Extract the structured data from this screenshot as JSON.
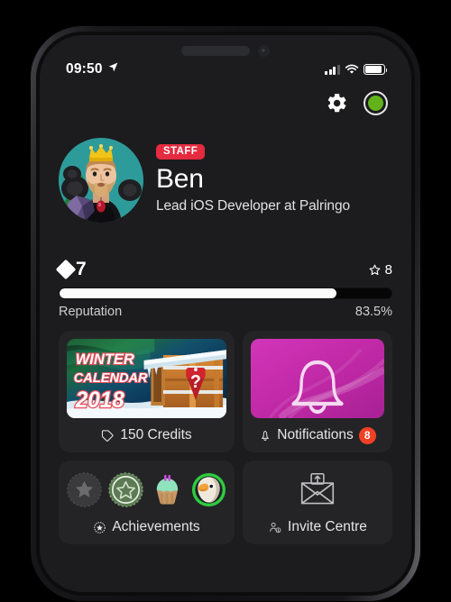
{
  "status_bar": {
    "time": "09:50",
    "location_icon": "location-arrow-icon",
    "signal_icon": "cellular-bars-icon",
    "wifi_icon": "wifi-icon",
    "battery_icon": "battery-full-icon"
  },
  "top_actions": {
    "settings_icon": "gear-icon",
    "online_status_icon": "online-status-dot",
    "online_status_color": "#62b31b"
  },
  "profile": {
    "badge": "STAFF",
    "badge_color": "#e52b3f",
    "name": "Ben",
    "subtitle": "Lead iOS Developer at Palringo",
    "avatar_background": "#2e9b9b",
    "avatar_icon": "user-avatar"
  },
  "reputation": {
    "level_icon": "diamond-icon",
    "level": "7",
    "star_icon": "star-outline-icon",
    "stars": "8",
    "label": "Reputation",
    "percent": "83.5%",
    "progress": 83.5,
    "fill_color": "#fafafa"
  },
  "cards": [
    {
      "name": "winter-calendar",
      "media_type": "winter-calendar-art",
      "art_title_line1": "WINTER",
      "art_title_line2": "CALENDAR",
      "art_title_line3": "2018",
      "footer_icon": "credits-tag-icon",
      "footer_label": "150 Credits",
      "badge": null
    },
    {
      "name": "notifications",
      "media_type": "notification-bell-art",
      "footer_icon": "bell-icon",
      "footer_label": "Notifications",
      "badge": "8",
      "badge_color": "#f04124",
      "media_color": "#c32ab0"
    },
    {
      "name": "achievements",
      "media_type": "achievement-badges",
      "footer_icon": "achievement-icon",
      "footer_label": "Achievements",
      "badge": null,
      "badges": [
        {
          "name": "locked-star-badge",
          "color": "#3a3a3c"
        },
        {
          "name": "green-star-badge",
          "color": "#5d7a54"
        },
        {
          "name": "cupcake-badge",
          "color": "#8ae0b8"
        },
        {
          "name": "eagle-badge",
          "color": "#2ecc40"
        }
      ]
    },
    {
      "name": "invite-centre",
      "media_type": "invite-envelope-icon",
      "footer_icon": "invite-people-icon",
      "footer_label": "Invite Centre",
      "badge": null
    }
  ]
}
